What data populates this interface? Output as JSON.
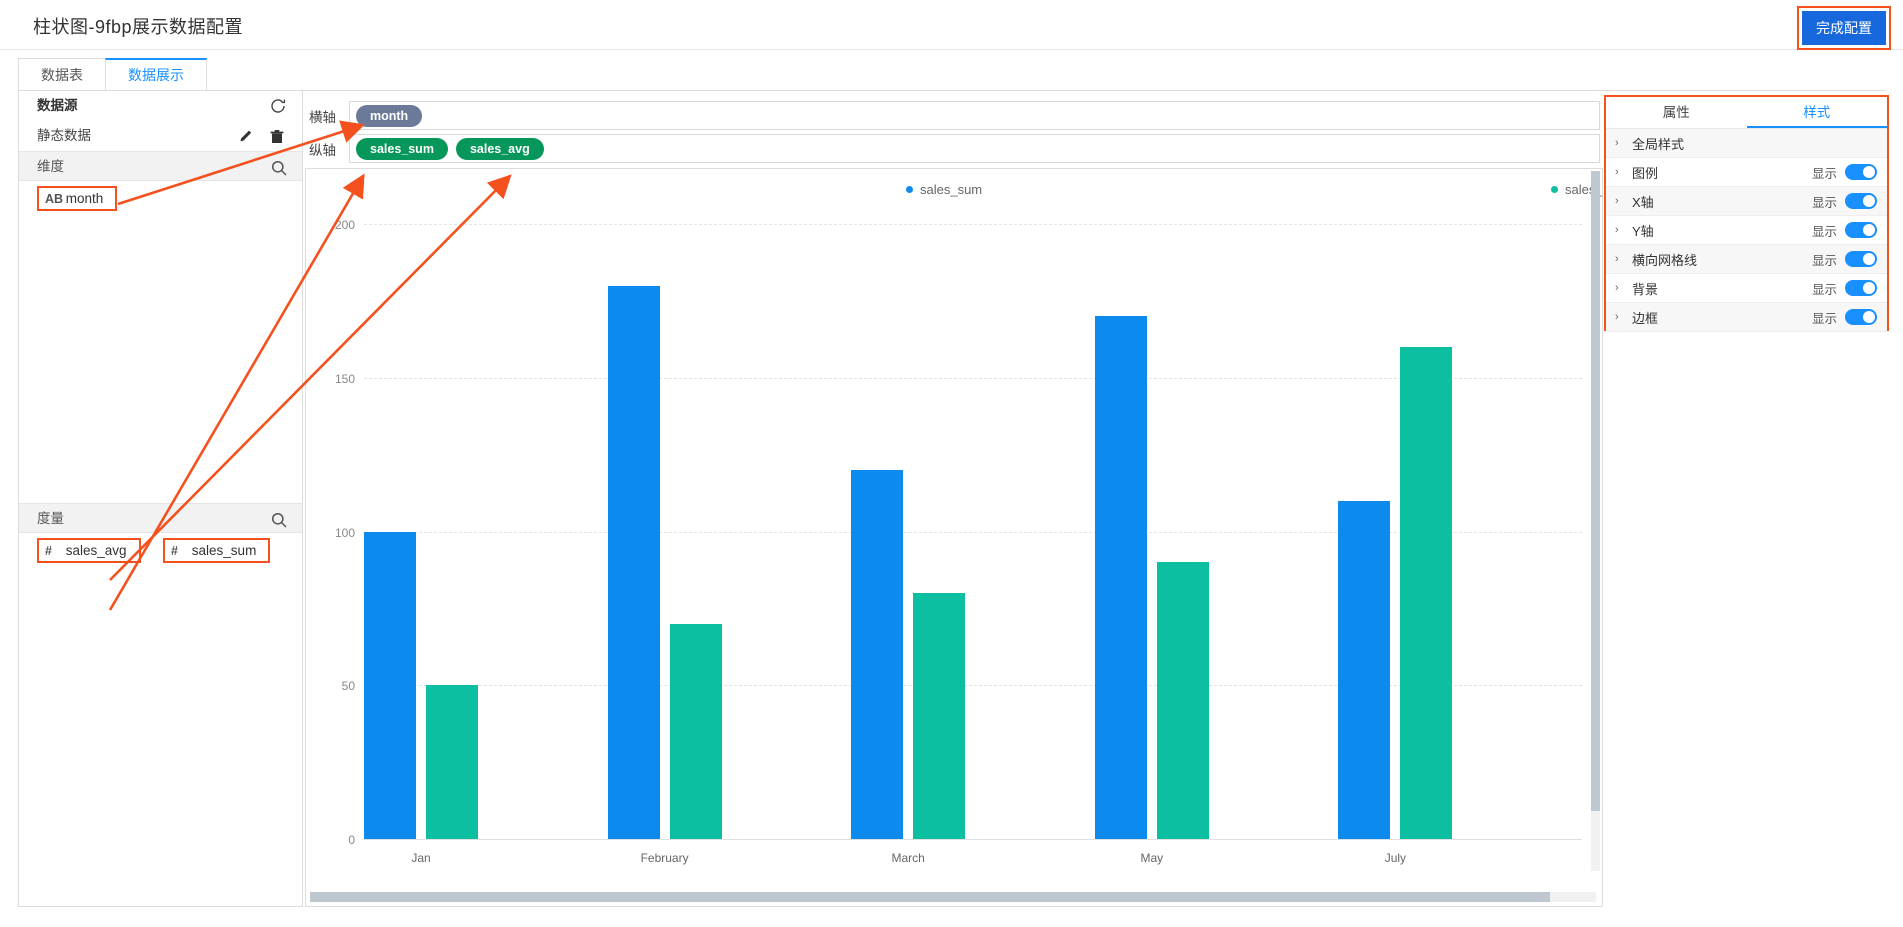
{
  "header": {
    "title": "柱状图-9fbp展示数据配置",
    "finish_button": "完成配置"
  },
  "tabs": [
    {
      "label": "数据表",
      "active": false
    },
    {
      "label": "数据展示",
      "active": true
    }
  ],
  "left_panel": {
    "datasource": {
      "title": "数据源",
      "refresh_icon": "refresh-icon",
      "item": "静态数据",
      "edit_icon": "edit-icon",
      "delete_icon": "delete-icon"
    },
    "dimensions": {
      "title": "维度",
      "search_icon": "search-icon",
      "items": [
        {
          "type": "AB",
          "name": "month"
        }
      ]
    },
    "measures": {
      "title": "度量",
      "search_icon": "search-icon",
      "items": [
        {
          "type": "#",
          "name": "sales_avg"
        },
        {
          "type": "#",
          "name": "sales_sum"
        }
      ]
    }
  },
  "axis_config": {
    "x_axis": {
      "label": "横轴",
      "pills": [
        "month"
      ]
    },
    "y_axis": {
      "label": "纵轴",
      "pills": [
        "sales_sum",
        "sales_avg"
      ]
    }
  },
  "right_panel": {
    "tabs": [
      {
        "label": "属性",
        "active": false
      },
      {
        "label": "样式",
        "active": true
      }
    ],
    "rows": [
      {
        "label": "全局样式",
        "has_toggle": false,
        "show_label": "",
        "toggle_on": false
      },
      {
        "label": "图例",
        "has_toggle": true,
        "show_label": "显示",
        "toggle_on": true
      },
      {
        "label": "X轴",
        "has_toggle": true,
        "show_label": "显示",
        "toggle_on": true
      },
      {
        "label": "Y轴",
        "has_toggle": true,
        "show_label": "显示",
        "toggle_on": true
      },
      {
        "label": "横向网格线",
        "has_toggle": true,
        "show_label": "显示",
        "toggle_on": true
      },
      {
        "label": "背景",
        "has_toggle": true,
        "show_label": "显示",
        "toggle_on": true
      },
      {
        "label": "边框",
        "has_toggle": true,
        "show_label": "显示",
        "toggle_on": true
      }
    ]
  },
  "colors": {
    "series_sales_sum": "#0d8aee",
    "series_sales_avg": "#0bbfa0",
    "accent": "#1890ff",
    "annotation": "#f4511e",
    "primary_button": "#1668dc",
    "pill_dimension": "#6b7a99",
    "pill_measure": "#07975b"
  },
  "chart_data": {
    "type": "bar",
    "title": "",
    "xlabel": "",
    "ylabel": "",
    "categories": [
      "Jan",
      "February",
      "March",
      "May",
      "July"
    ],
    "series": [
      {
        "name": "sales_sum",
        "color": "#0d8aee",
        "values": [
          100,
          180,
          120,
          170,
          110
        ]
      },
      {
        "name": "sales_avg",
        "color": "#0bbfa0",
        "values": [
          50,
          70,
          80,
          90,
          160
        ]
      }
    ],
    "ylim": [
      0,
      200
    ],
    "yticks": [
      0,
      50,
      100,
      150,
      200
    ],
    "ytick_labels": [
      "0",
      "50",
      "100",
      "150",
      "200"
    ],
    "grid": true,
    "legend": [
      "sales_sum",
      "sales_avg"
    ],
    "legend_position": "top"
  }
}
